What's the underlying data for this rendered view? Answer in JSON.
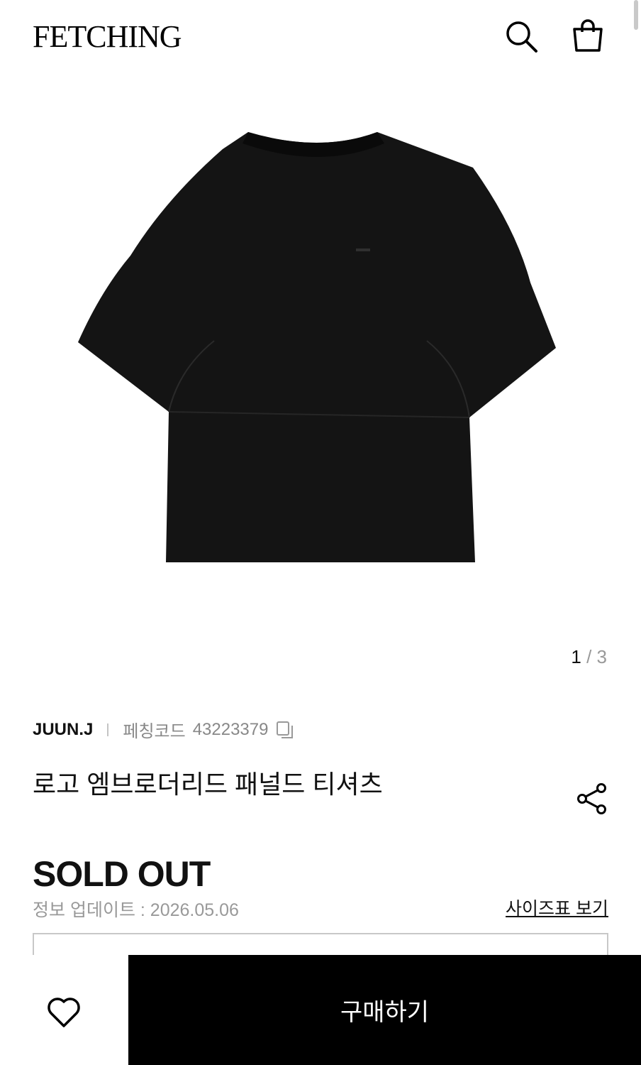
{
  "header": {
    "logo": "FETCHING",
    "search_icon": "search-icon",
    "bag_icon": "shopping-bag-icon"
  },
  "gallery": {
    "current": "1",
    "separator": "/",
    "total": "3"
  },
  "product": {
    "brand": "JUUN.J",
    "code_label": "페칭코드",
    "code": "43223379",
    "name": "로고 엠브로더리드 패널드 티셔츠",
    "status": "SOLD OUT",
    "updated": "정보 업데이트 : 2026.05.06",
    "size_chart_label": "사이즈표 보기"
  },
  "bottom_bar": {
    "buy_label": "구매하기",
    "wish_icon": "heart-icon"
  },
  "colors": {
    "primary": "#000000",
    "muted": "#999999",
    "border": "#c8c8c8"
  }
}
